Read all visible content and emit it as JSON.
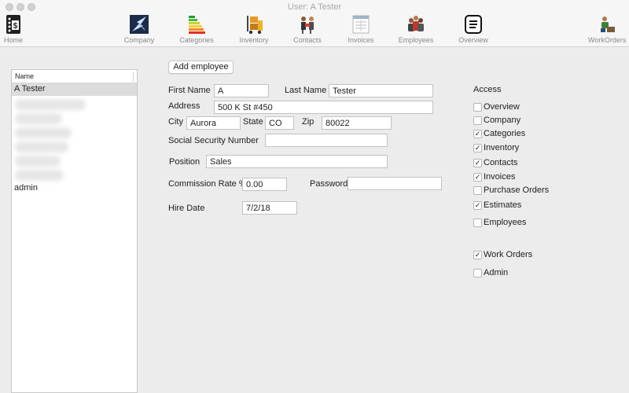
{
  "window": {
    "title": "User: A Tester"
  },
  "toolbar": {
    "items": [
      {
        "label": "Home"
      },
      {
        "label": "Company"
      },
      {
        "label": "Categories"
      },
      {
        "label": "Inventory"
      },
      {
        "label": "Contacts"
      },
      {
        "label": "Invoices"
      },
      {
        "label": "Employees"
      },
      {
        "label": "Overview"
      },
      {
        "label": "WorkOrders"
      }
    ]
  },
  "employee_list": {
    "column_header": "Name",
    "rows": [
      {
        "name": "A Tester",
        "selected": true
      },
      {
        "name": "admin",
        "selected": false
      }
    ]
  },
  "form": {
    "add_button": "Add employee",
    "first_name_label": "First Name",
    "first_name": "A",
    "last_name_label": "Last Name",
    "last_name": "Tester",
    "address_label": "Address",
    "address": "500 K St #450",
    "city_label": "City",
    "city": "Aurora",
    "state_label": "State",
    "state": "CO",
    "zip_label": "Zip",
    "zip": "80022",
    "ssn_label": "Social Security Number",
    "ssn": "",
    "position_label": "Position",
    "position": "Sales",
    "commission_label": "Commission Rate %",
    "commission": "0.00",
    "password_label": "Password",
    "password": "",
    "hire_date_label": "Hire Date",
    "hire_date": "7/2/18"
  },
  "access": {
    "title": "Access",
    "items": [
      {
        "label": "Overview",
        "checked": false
      },
      {
        "label": "Company",
        "checked": false
      },
      {
        "label": "Categories",
        "checked": true
      },
      {
        "label": "Inventory",
        "checked": true
      },
      {
        "label": "Contacts",
        "checked": true
      },
      {
        "label": "Invoices",
        "checked": true
      },
      {
        "label": "Purchase Orders",
        "checked": false
      },
      {
        "label": "Estimates",
        "checked": true
      },
      {
        "label": "Employees",
        "checked": false
      },
      {
        "label": "Work Orders",
        "checked": true
      },
      {
        "label": "Admin",
        "checked": false
      }
    ]
  }
}
